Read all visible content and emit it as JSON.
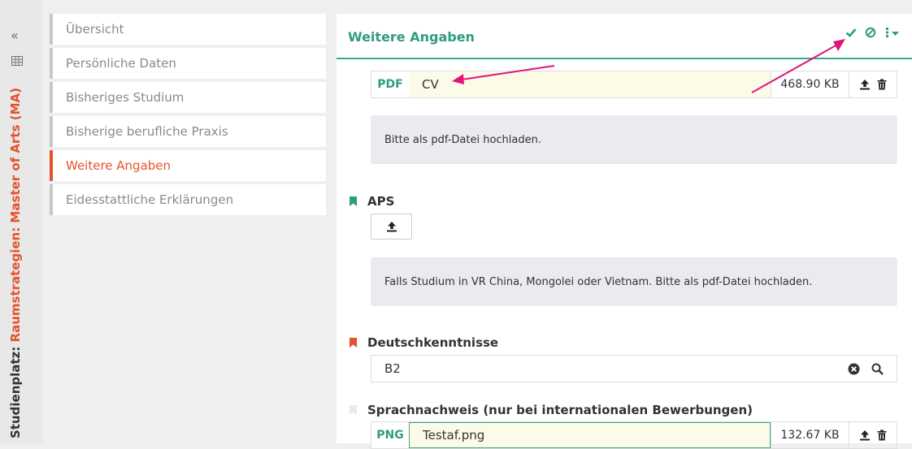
{
  "rail": {
    "vertical_label_prefix": "Studienplatz:",
    "vertical_label_program": "Raumstrategien: Master of Arts (MA)"
  },
  "nav": {
    "items": [
      {
        "label": "Übersicht"
      },
      {
        "label": "Persönliche Daten"
      },
      {
        "label": "Bisheriges Studium"
      },
      {
        "label": "Bisherige berufliche Praxis"
      },
      {
        "label": "Weitere Angaben",
        "active": true
      },
      {
        "label": "Eidesstattliche Erklärungen"
      }
    ]
  },
  "panel": {
    "title": "Weitere Angaben",
    "cv_file": {
      "type": "PDF",
      "name": "CV",
      "size": "468.90 KB"
    },
    "cv_hint": "Bitte als pdf-Datei hochladen.",
    "aps_label": "APS",
    "aps_hint": "Falls Studium in VR China, Mongolei oder Vietnam. Bitte als pdf-Datei hochladen.",
    "deutsch_label": "Deutschkenntnisse",
    "deutsch_value": "B2",
    "sprach_label": "Sprachnachweis (nur bei internationalen Bewerbungen)",
    "sprach_file": {
      "type": "PNG",
      "name": "Testaf.png",
      "size": "132.67 KB"
    }
  },
  "colors": {
    "accent_green": "#2f9c80",
    "accent_orange": "#e3532d",
    "annotation_arrow": "#e0157a"
  },
  "icons": [
    "collapse-icon",
    "grid-icon",
    "check-icon",
    "cancel-icon",
    "more-icon",
    "upload-icon",
    "trash-icon",
    "bookmark-icon",
    "clear-icon",
    "search-icon"
  ]
}
